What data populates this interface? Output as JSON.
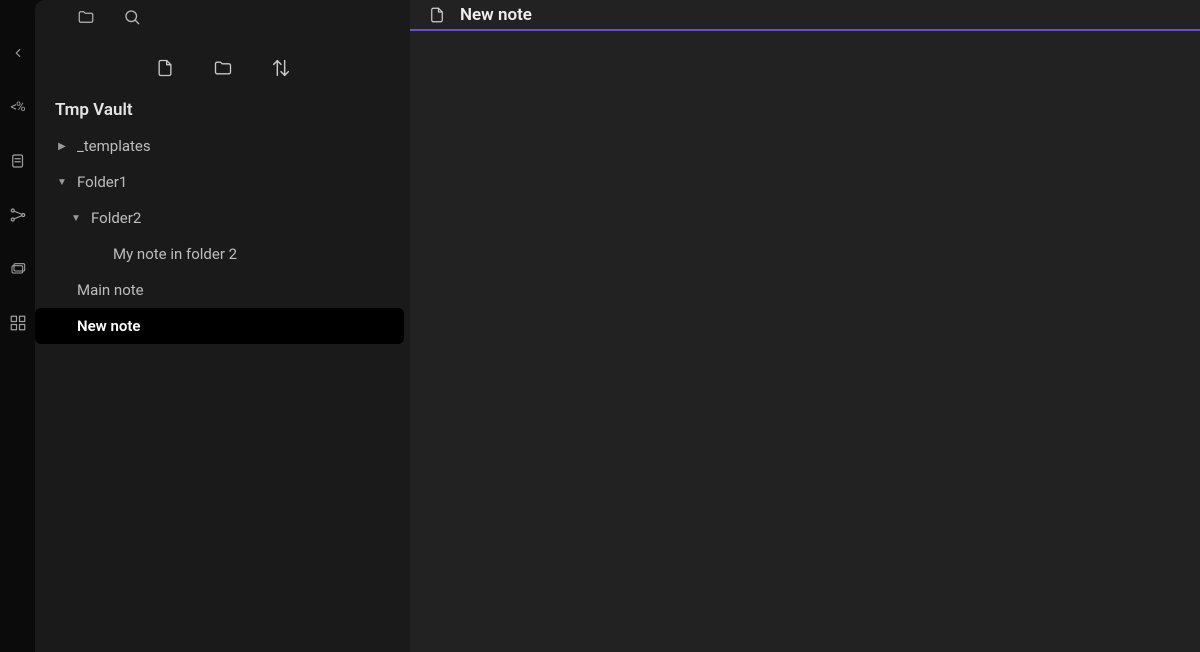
{
  "ribbon": {
    "items": [
      {
        "name": "back-icon"
      },
      {
        "name": "templater-icon"
      },
      {
        "name": "snippets-icon"
      },
      {
        "name": "graph-icon"
      },
      {
        "name": "cards-icon"
      },
      {
        "name": "grid-icon"
      }
    ]
  },
  "sidebar": {
    "tabs": {
      "files_active": true
    },
    "toolbar": {
      "new_file": "new-file",
      "new_folder": "new-folder",
      "sort": "sort"
    },
    "vault_title": "Tmp Vault",
    "tree": {
      "templates": {
        "label": "_templates",
        "expanded": false
      },
      "folder1": {
        "label": "Folder1",
        "expanded": true
      },
      "folder2": {
        "label": "Folder2",
        "expanded": true
      },
      "note_f2": {
        "label": "My note in folder 2"
      },
      "main_note": {
        "label": "Main note"
      },
      "new_note": {
        "label": "New note",
        "active": true
      }
    }
  },
  "main": {
    "tab_title": "New note"
  },
  "accent": "#6b4cd6"
}
